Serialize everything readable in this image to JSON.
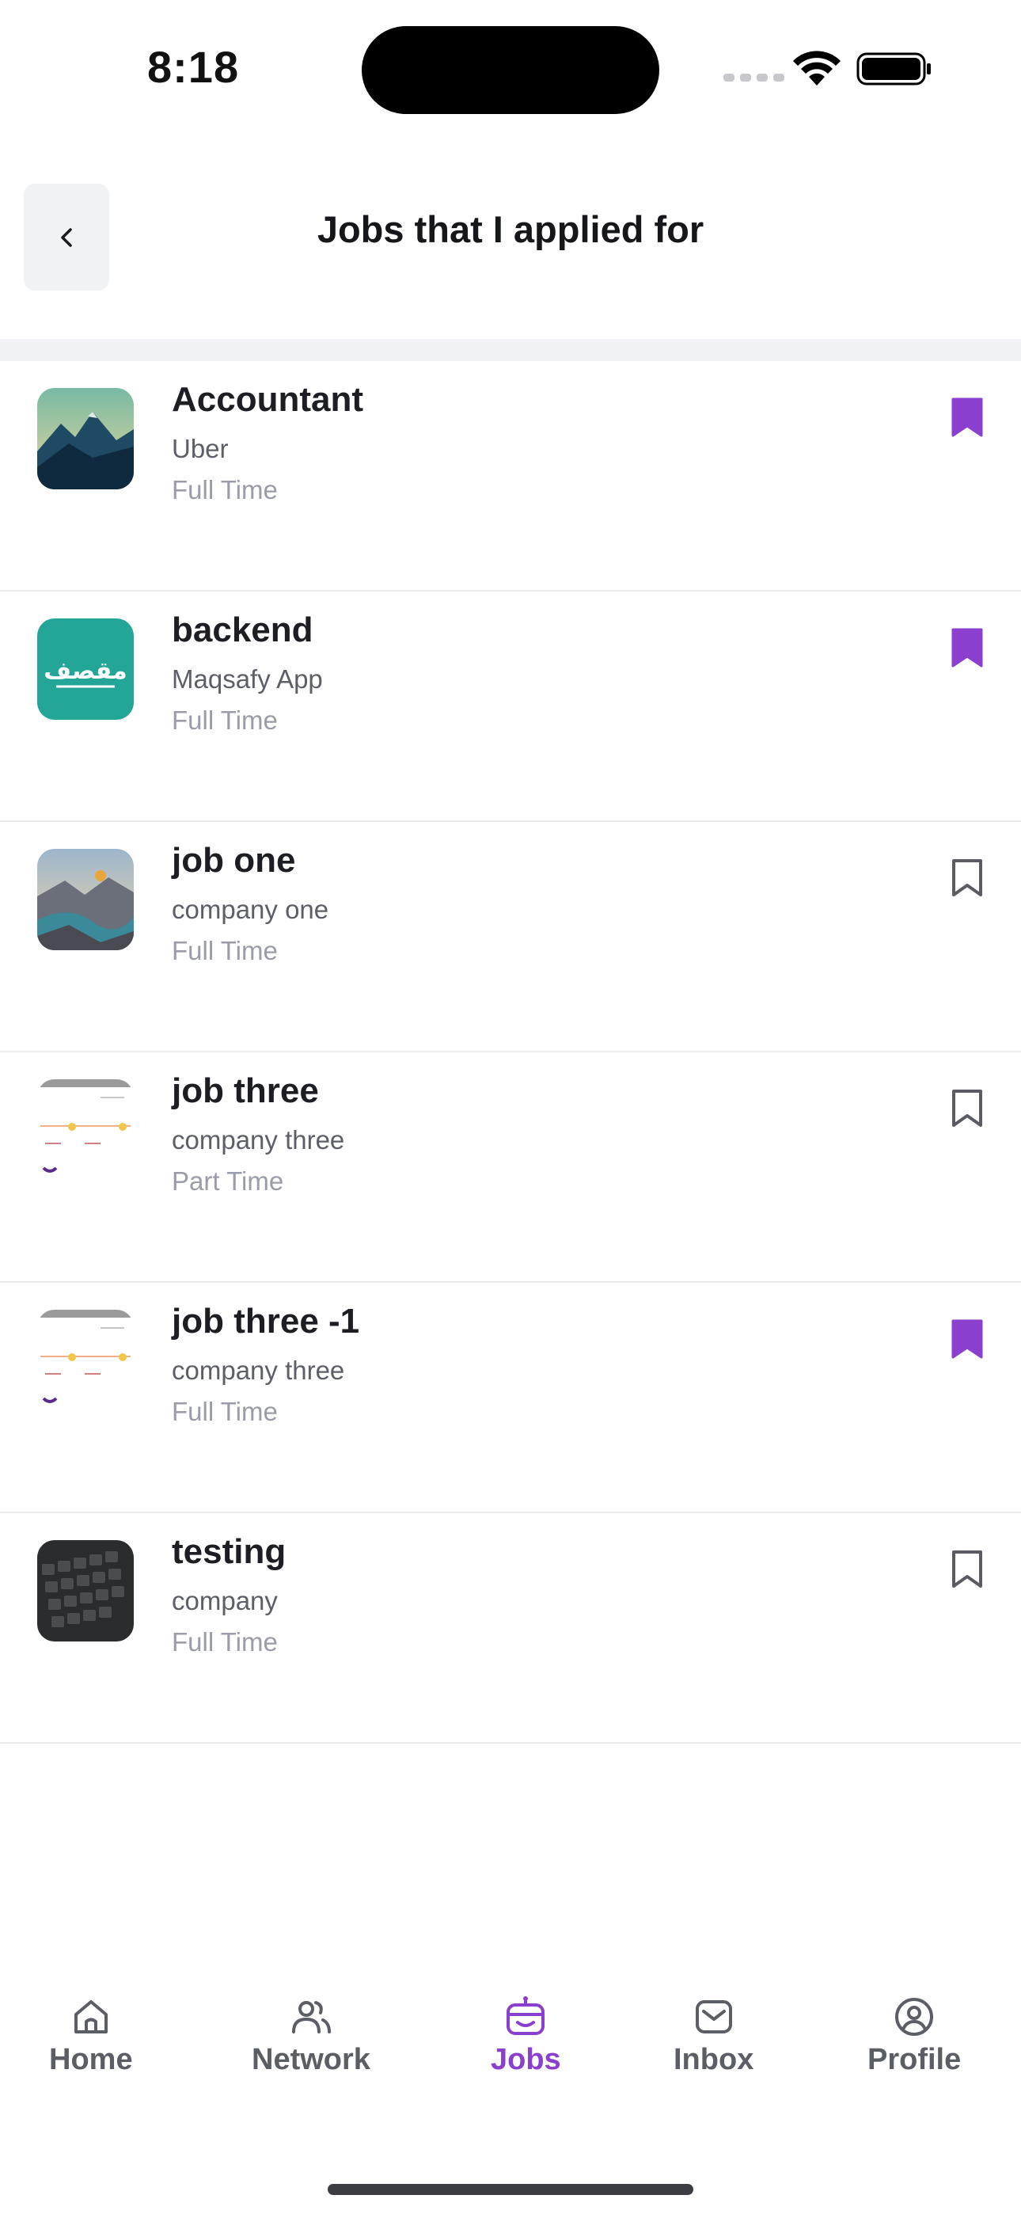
{
  "status_bar": {
    "time": "8:18"
  },
  "header": {
    "title": "Jobs that I applied for",
    "back_icon": "chevron-left-icon"
  },
  "colors": {
    "accent": "#8a3fcf",
    "bookmark_outline": "#5a5b63",
    "divider": "#f1f2f5"
  },
  "jobs": [
    {
      "title": "Accountant",
      "company": "Uber",
      "type": "Full Time",
      "bookmarked": true,
      "thumbnail": "mountain-photo"
    },
    {
      "title": "backend",
      "company": "Maqsafy App",
      "type": "Full Time",
      "bookmarked": true,
      "thumbnail": "maqsafy-logo",
      "logo_text": "مقصف"
    },
    {
      "title": "job one",
      "company": "company one",
      "type": "Full Time",
      "bookmarked": false,
      "thumbnail": "lake-balloon-photo"
    },
    {
      "title": "job three",
      "company": "company three",
      "type": "Part Time",
      "bookmarked": false,
      "thumbnail": "screenshot-thumbnail"
    },
    {
      "title": "job three -1",
      "company": "company three",
      "type": "Full Time",
      "bookmarked": true,
      "thumbnail": "screenshot-thumbnail"
    },
    {
      "title": "testing",
      "company": "company",
      "type": "Full Time",
      "bookmarked": false,
      "thumbnail": "keyboard-photo"
    }
  ],
  "nav": {
    "items": [
      {
        "label": "Home",
        "icon": "home-icon",
        "active": false
      },
      {
        "label": "Network",
        "icon": "users-icon",
        "active": false
      },
      {
        "label": "Jobs",
        "icon": "briefcase-bot-icon",
        "active": true
      },
      {
        "label": "Inbox",
        "icon": "inbox-icon",
        "active": false
      },
      {
        "label": "Profile",
        "icon": "user-circle-icon",
        "active": false
      }
    ]
  }
}
